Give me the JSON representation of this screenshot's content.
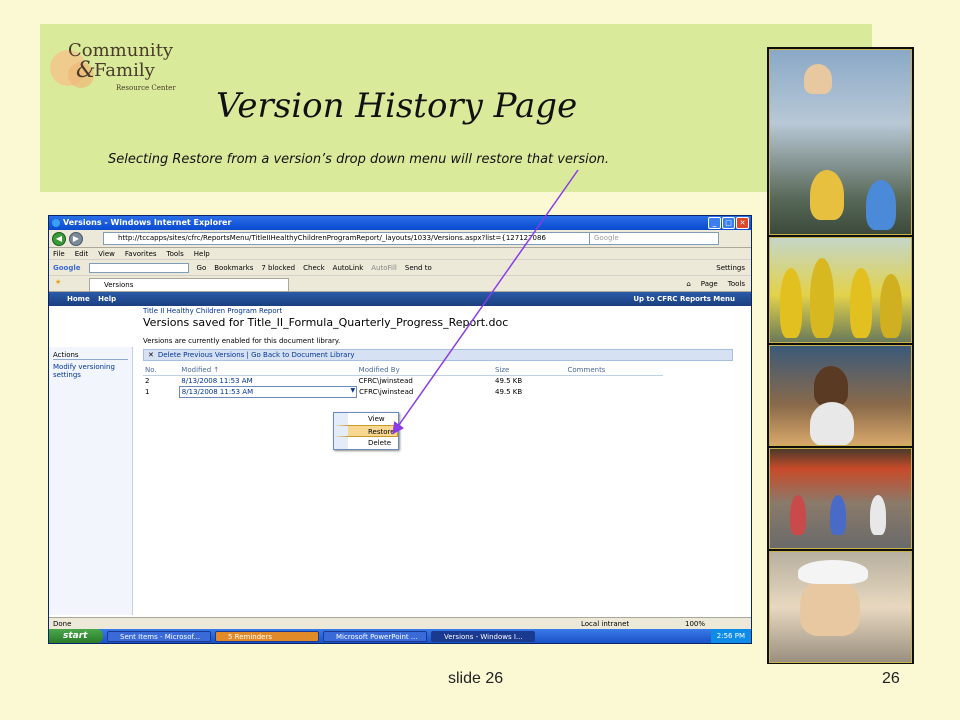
{
  "logo": {
    "line1": "Community",
    "amp": "&",
    "line2": "Family",
    "sub": "Resource Center"
  },
  "slide": {
    "title": "Version History Page",
    "subtitle": "Selecting Restore from a version’s drop down menu will restore that version.",
    "footer_label": "slide 26",
    "page_number": "26"
  },
  "window": {
    "title": "Versions - Windows Internet Explorer",
    "url": "http://tccapps/sites/cfrc/ReportsMenu/TitleIIHealthyChildrenProgramReport/_layouts/1033/Versions.aspx?list={127127086",
    "search_placeholder": "Google",
    "menu": [
      "File",
      "Edit",
      "View",
      "Favorites",
      "Tools",
      "Help"
    ],
    "google_toolbar": {
      "google": "Google",
      "go": "Go",
      "bookmarks": "Bookmarks",
      "blocked": "7 blocked",
      "check": "Check",
      "autolink": "AutoLink",
      "autofill": "AutoFill",
      "sendto": "Send to",
      "settings": "Settings"
    },
    "tab_label": "Versions",
    "page_menu": "Page",
    "tools_menu": "Tools"
  },
  "sharepoint": {
    "home": "Home",
    "help": "Help",
    "up_to": "Up to CFRC Reports Menu",
    "breadcrumb": "Title II Healthy Children Program Report",
    "heading": "Versions saved for Title_II_Formula_Quarterly_Progress_Report.doc",
    "note": "Versions are currently enabled for this document library.",
    "toolbar_delete": "Delete Previous Versions",
    "toolbar_sep": "|",
    "toolbar_back": "Go Back to Document Library",
    "actions_heading": "Actions",
    "action_modify": "Modify versioning settings",
    "columns": [
      "No.",
      "Modified",
      "Modified By",
      "Size",
      "Comments"
    ],
    "modified_sort": "↑",
    "rows": [
      {
        "no": "2",
        "modified": "8/13/2008 11:53 AM",
        "by": "CFRC\\jwinstead",
        "size": "49.5 KB",
        "comments": ""
      },
      {
        "no": "1",
        "modified": "8/13/2008 11:53 AM",
        "by": "CFRC\\jwinstead",
        "size": "49.5 KB",
        "comments": ""
      }
    ],
    "context_menu": [
      "View",
      "Restore",
      "Delete"
    ],
    "context_selected": "Restore"
  },
  "status": {
    "left": "Done",
    "zone": "Local intranet",
    "zoom": "100%"
  },
  "taskbar": {
    "start": "start",
    "items": [
      "Sent Items - Microsof...",
      "5 Reminders",
      "Microsoft PowerPoint ...",
      "Versions - Windows I..."
    ],
    "clock": "2:56 PM"
  },
  "colors": {
    "background": "#fbf9d4",
    "header_panel": "#d9eb9b",
    "arrow": "#8a3ae8",
    "highlight": "#f8d890"
  }
}
